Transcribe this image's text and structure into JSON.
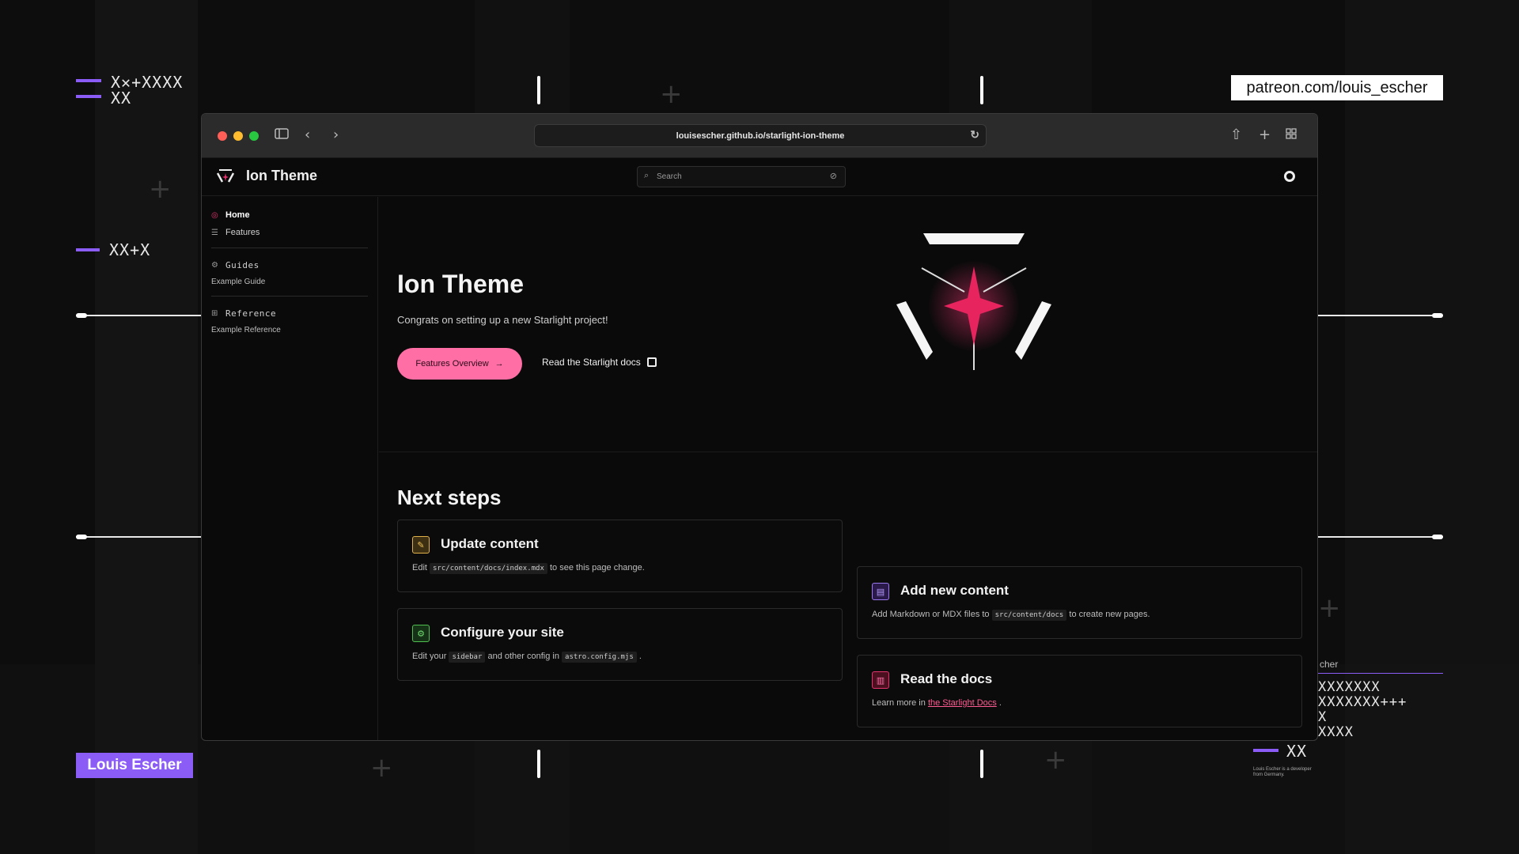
{
  "overlay": {
    "patreon": "patreon.com/louis_escher",
    "author": "Louis Escher",
    "caption_partial": "cher",
    "tiny_note": "Louis Escher is a developer from Germany."
  },
  "browser": {
    "url": "louisescher.github.io/starlight-ion-theme"
  },
  "site": {
    "title": "Ion Theme",
    "search_placeholder": "Search"
  },
  "sidebar": {
    "home": "Home",
    "features": "Features",
    "guides": "Guides",
    "example_guide": "Example Guide",
    "reference": "Reference",
    "example_reference": "Example Reference"
  },
  "hero": {
    "title": "Ion Theme",
    "tagline": "Congrats on setting up a new Starlight project!",
    "primary_button": "Features Overview",
    "secondary_link": "Read the Starlight docs"
  },
  "next_steps": {
    "title": "Next steps",
    "cards": [
      {
        "title": "Update content",
        "pre": "Edit ",
        "code": "src/content/docs/index.mdx",
        "post": " to see this page change."
      },
      {
        "title": "Configure your site",
        "pre": "Edit your ",
        "code": "sidebar",
        "mid": " and other config in ",
        "code2": "astro.config.mjs",
        "post": "."
      },
      {
        "title": "Add new content",
        "pre": "Add Markdown or MDX files to ",
        "code": "src/content/docs",
        "post": " to create new pages."
      },
      {
        "title": "Read the docs",
        "pre": "Learn more in ",
        "link": "the Starlight Docs",
        "post": "."
      }
    ]
  },
  "colors": {
    "accent": "#ff6fa6",
    "brand_pink": "#e4336f",
    "purple": "#8b5cf6"
  }
}
